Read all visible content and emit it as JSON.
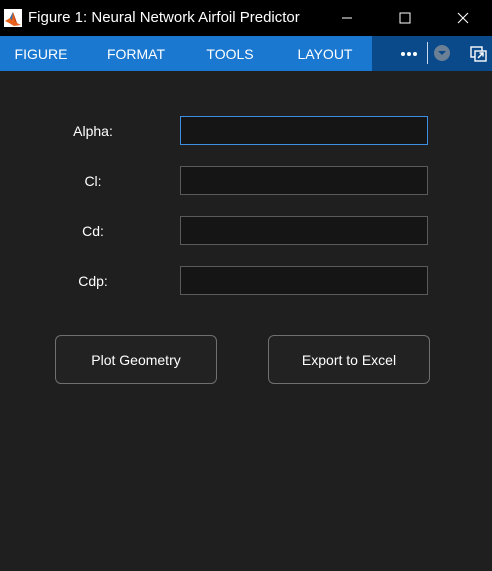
{
  "window": {
    "title": "Figure 1: Neural Network Airfoil Predictor"
  },
  "toolstrip": {
    "tabs": [
      {
        "label": "FIGURE"
      },
      {
        "label": "FORMAT"
      },
      {
        "label": "TOOLS"
      },
      {
        "label": "LAYOUT"
      }
    ],
    "more_icon": "more-horizontal-icon",
    "collapse_icon": "collapse-toolstrip-icon",
    "undock_icon": "undock-icon"
  },
  "form": {
    "fields": [
      {
        "label": "Alpha:",
        "value": ""
      },
      {
        "label": "Cl:",
        "value": ""
      },
      {
        "label": "Cd:",
        "value": ""
      },
      {
        "label": "Cdp:",
        "value": ""
      }
    ],
    "buttons": {
      "plot": "Plot Geometry",
      "export": "Export to Excel"
    }
  },
  "colors": {
    "titlebar": "#000000",
    "toolstrip": "#1a78d0",
    "toolstrip_right": "#0a4a8a",
    "background": "#1f1f1f",
    "focus_border": "#3f8fe0"
  }
}
